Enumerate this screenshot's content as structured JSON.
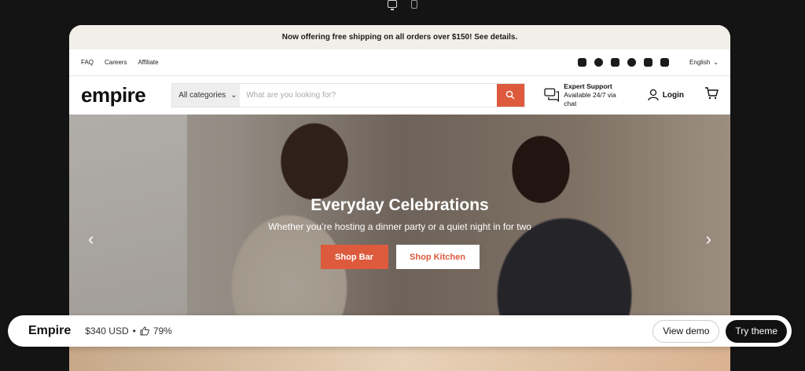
{
  "colors": {
    "accent": "#dd5a3d",
    "dark": "#111111",
    "announce_bg": "#f2efe9"
  },
  "announcement": "Now offering free shipping on all orders over $150! See details.",
  "utility": {
    "links": [
      "FAQ",
      "Careers",
      "Affiliate"
    ],
    "social_icons": [
      "email-icon",
      "facebook-icon",
      "instagram-icon",
      "pinterest-icon",
      "snapchat-icon",
      "tiktok-icon"
    ],
    "language": "English"
  },
  "header": {
    "logo": "empire",
    "search_category": "All categories",
    "search_placeholder": "What are you looking for?",
    "support_title": "Expert Support",
    "support_sub": "Available 24/7 via chat",
    "login": "Login"
  },
  "hero": {
    "title": "Everyday Celebrations",
    "subtitle": "Whether you’re hosting a dinner party or a quiet night in for two",
    "btn1": "Shop Bar",
    "btn2": "Shop Kitchen",
    "prev": "‹",
    "next": "›"
  },
  "bottom_bar": {
    "theme_name": "Empire",
    "price": "$340 USD",
    "rating": "79%",
    "view_demo": "View demo",
    "try_theme": "Try theme"
  }
}
